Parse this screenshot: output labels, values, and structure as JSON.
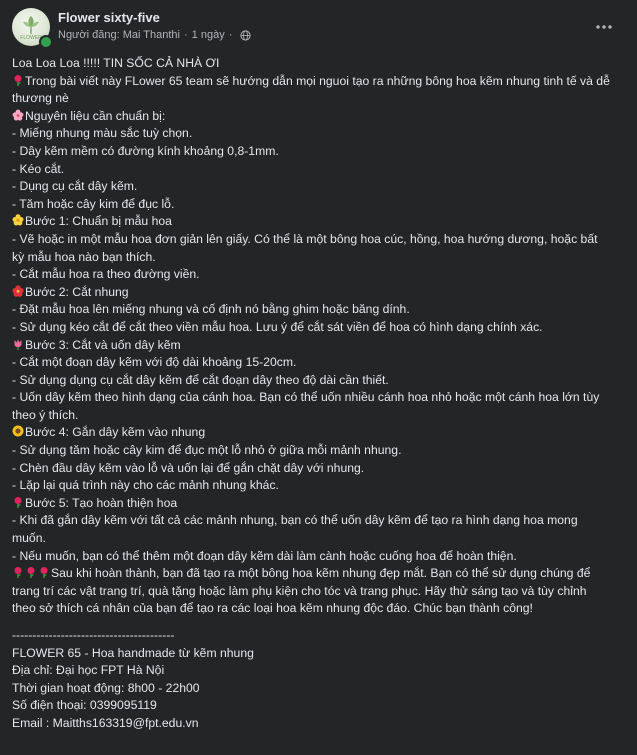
{
  "header": {
    "page_name": "Flower sixty-five",
    "posted_by": "Người đăng: Mai Thanthi",
    "separator": "·",
    "time": "1 ngày",
    "avatar_text": "FLOWER"
  },
  "icons": {
    "globe": "globe-icon",
    "more": "more-horizontal-icon",
    "rose": "rose-emoji",
    "cherry_blossom": "cherry-blossom-emoji",
    "blossom": "blossom-emoji",
    "hibiscus": "hibiscus-emoji",
    "tulip": "tulip-emoji",
    "sunflower": "sunflower-emoji"
  },
  "colors": {
    "background": "#242526",
    "text": "#e4e6eb",
    "secondary_text": "#b0b3b8",
    "online": "#31a24c"
  },
  "post": {
    "intro_1": "Loa Loa Loa !!!!! TIN SỐC CẢ NHÀ ƠI",
    "intro_2": "Trong bài viết này FLower 65 team sẽ hướng dẫn mọi nguoi tạo ra những bông hoa kẽm nhung tinh tế và dễ thương nè",
    "materials_title": "Nguyên liệu cần chuẩn bị:",
    "materials": [
      "- Miếng nhung màu sắc tuỳ chọn.",
      "- Dây kẽm mềm có đường kính khoảng 0,8-1mm.",
      "- Kéo cắt.",
      "- Dụng cụ cắt dây kẽm.",
      "- Tăm hoặc cây kim để đục lỗ."
    ],
    "step1_title": "Bước 1: Chuẩn bị mẫu hoa",
    "step1": [
      "- Vẽ hoặc in một mẫu hoa đơn giản lên giấy. Có thể là một bông hoa cúc, hồng, hoa hướng dương, hoặc bất kỳ mẫu hoa nào bạn thích.",
      "- Cắt mẫu hoa ra theo đường viền."
    ],
    "step2_title": "Bước 2: Cắt nhung",
    "step2": [
      "- Đặt mẫu hoa lên miếng nhung và cố định nó bằng ghim hoặc băng dính.",
      "- Sử dụng kéo cắt để cắt theo viền mẫu hoa. Lưu ý để cắt sát viền để hoa có hình dạng chính xác."
    ],
    "step3_title": "Bước 3: Cắt và uốn dây kẽm",
    "step3": [
      "- Cắt một đoạn dây kẽm với độ dài khoảng 15-20cm.",
      "- Sử dụng dụng cụ cắt dây kẽm để cắt đoạn dây theo độ dài cần thiết.",
      "- Uốn dây kẽm theo hình dạng của cánh hoa. Bạn có thể uốn nhiều cánh hoa nhỏ hoặc một cánh hoa lớn tùy theo ý thích."
    ],
    "step4_title": "Bước 4: Gắn dây kẽm vào nhung",
    "step4": [
      "- Sử dụng tăm hoặc cây kim để đục một lỗ nhỏ ở giữa mỗi mảnh nhung.",
      "- Chèn đầu dây kẽm vào lỗ và uốn lại để gắn chặt dây với nhung.",
      "- Lặp lại quá trình này cho các mảnh nhung khác."
    ],
    "step5_title": "Bước 5: Tạo hoàn thiện hoa",
    "step5": [
      "- Khi đã gắn dây kẽm với tất cả các mảnh nhung, bạn có thể uốn dây kẽm để tạo ra hình dạng hoa mong muốn.",
      "- Nếu muốn, bạn có thể thêm một đoạn dây kẽm dài làm cành hoặc cuống hoa để hoàn thiện."
    ],
    "closing": "Sau khi hoàn thành, bạn đã tạo ra một bông hoa kẽm nhung đẹp mắt. Bạn có thể sử dụng chúng để trang trí các vật trang trí, quà tặng hoặc làm phụ kiện cho tóc và trang phục. Hãy thử sáng tạo và tùy chỉnh theo sở thích cá nhân của bạn để tạo ra các loại hoa kẽm nhung độc đáo. Chúc bạn thành công!",
    "divider": "----------------------------------------",
    "footer": [
      "FLOWER 65 - Hoa handmade từ kẽm nhung",
      "Địa chỉ: Đại học FPT Hà Nội",
      "Thời gian hoạt động: 8h00 - 22h00",
      "Số điện thoại: 0399095119",
      "Email : Maitths163319@fpt.edu.vn"
    ]
  }
}
